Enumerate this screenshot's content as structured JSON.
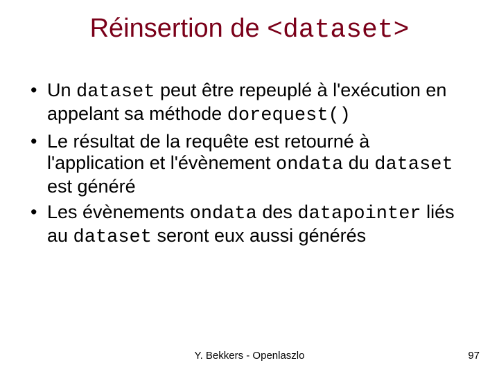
{
  "title": {
    "prefix": "Réinsertion de ",
    "code": "<dataset>"
  },
  "bullets": [
    {
      "parts": [
        {
          "t": "Un ",
          "c": false
        },
        {
          "t": "dataset",
          "c": true
        },
        {
          "t": " peut être repeuplé à l'exécution en appelant sa méthode ",
          "c": false
        },
        {
          "t": "dorequest()",
          "c": true
        }
      ]
    },
    {
      "parts": [
        {
          "t": "Le résultat de la requête est retourné à l'application et l'évènement ",
          "c": false
        },
        {
          "t": "ondata",
          "c": true
        },
        {
          "t": " du ",
          "c": false
        },
        {
          "t": "dataset",
          "c": true
        },
        {
          "t": " est généré",
          "c": false
        }
      ]
    },
    {
      "parts": [
        {
          "t": "Les évènements ",
          "c": false
        },
        {
          "t": "ondata",
          "c": true
        },
        {
          "t": " des ",
          "c": false
        },
        {
          "t": "datapointer",
          "c": true
        },
        {
          "t": " liés au ",
          "c": false
        },
        {
          "t": "dataset",
          "c": true
        },
        {
          "t": " seront eux aussi générés",
          "c": false
        }
      ]
    }
  ],
  "footer": {
    "author": "Y. Bekkers - Openlaszlo",
    "page": "97"
  }
}
